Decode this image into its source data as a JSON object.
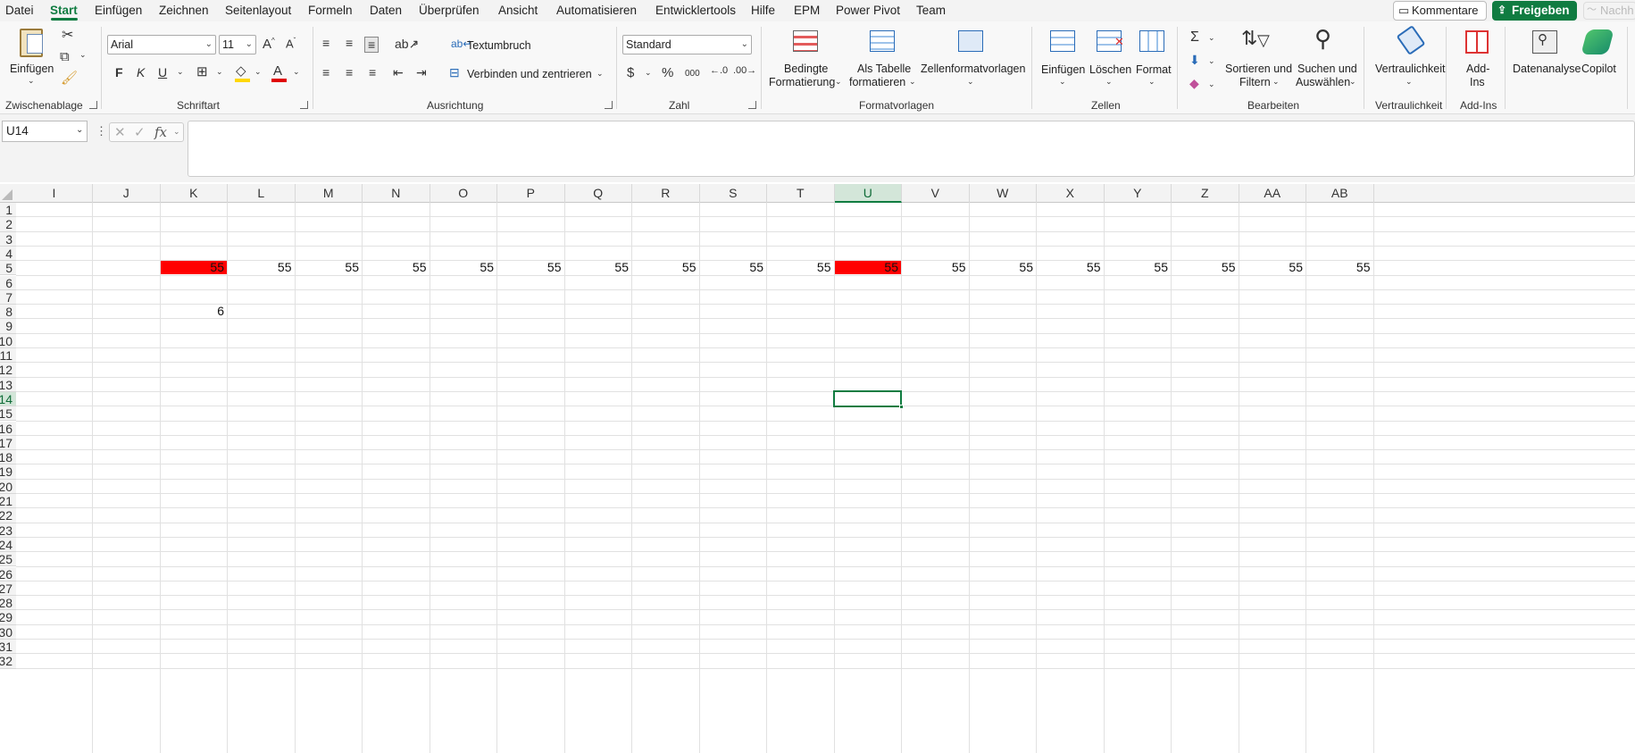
{
  "menu": {
    "items": [
      "Datei",
      "Start",
      "Einfügen",
      "Zeichnen",
      "Seitenlayout",
      "Formeln",
      "Daten",
      "Überprüfen",
      "Ansicht",
      "Automatisieren",
      "Entwicklertools",
      "Hilfe",
      "EPM",
      "Power Pivot",
      "Team"
    ],
    "active": "Start",
    "comments_label": "Kommentare",
    "share_label": "Freigeben",
    "next_label": "Nachh"
  },
  "ribbon": {
    "clipboard": {
      "paste_label": "Einfügen",
      "group_label": "Zwischenablage"
    },
    "font": {
      "font_name": "Arial",
      "font_size": "11",
      "bold": "F",
      "italic": "K",
      "underline": "U",
      "group_label": "Schriftart"
    },
    "alignment": {
      "wrap_label": "Textumbruch",
      "merge_label": "Verbinden und zentrieren",
      "group_label": "Ausrichtung"
    },
    "number": {
      "format": "Standard",
      "currency": "$",
      "percent": "%",
      "thousands": "000",
      "group_label": "Zahl"
    },
    "styles": {
      "conditional_l1": "Bedingte",
      "conditional_l2": "Formatierung",
      "table_l1": "Als Tabelle",
      "table_l2": "formatieren",
      "cellstyles_label": "Zellenformatvorlagen",
      "group_label": "Formatvorlagen"
    },
    "cells": {
      "insert_label": "Einfügen",
      "delete_label": "Löschen",
      "format_label": "Format",
      "group_label": "Zellen"
    },
    "editing": {
      "sort_l1": "Sortieren und",
      "sort_l2": "Filtern",
      "find_l1": "Suchen und",
      "find_l2": "Auswählen",
      "group_label": "Bearbeiten"
    },
    "sensitivity": {
      "label": "Vertraulichkeit",
      "group_label": "Vertraulichkeit"
    },
    "addins": {
      "label_l1": "Add-",
      "label_l2": "Ins",
      "group_label": "Add-Ins"
    },
    "analysis_label": "Datenanalyse",
    "copilot_label": "Copilot"
  },
  "formula_bar": {
    "name_box": "U14",
    "fx": "fx",
    "content": ""
  },
  "sheet": {
    "columns": [
      "I",
      "J",
      "K",
      "L",
      "M",
      "N",
      "O",
      "P",
      "Q",
      "R",
      "S",
      "T",
      "U",
      "V",
      "W",
      "X",
      "Y",
      "Z",
      "AA",
      "AB"
    ],
    "selected_column": "U",
    "rows": [
      "1",
      "2",
      "3",
      "4",
      "5",
      "6",
      "7",
      "8",
      "9",
      "10",
      "11",
      "12",
      "13",
      "14",
      "15",
      "16",
      "17",
      "18",
      "19",
      "20",
      "21",
      "22",
      "23",
      "24",
      "25",
      "26",
      "27",
      "28",
      "29",
      "30",
      "31",
      "32"
    ],
    "selected_row": "14",
    "active_cell": "U14",
    "fill_color": "#ff0000",
    "row5_values": [
      "55",
      "55",
      "55",
      "55",
      "55",
      "55",
      "55",
      "55",
      "55",
      "55",
      "55",
      "55",
      "55",
      "55",
      "55",
      "55",
      "55",
      "55"
    ],
    "row5_red_cells": [
      "K5",
      "U5"
    ],
    "k8_value": "6"
  }
}
